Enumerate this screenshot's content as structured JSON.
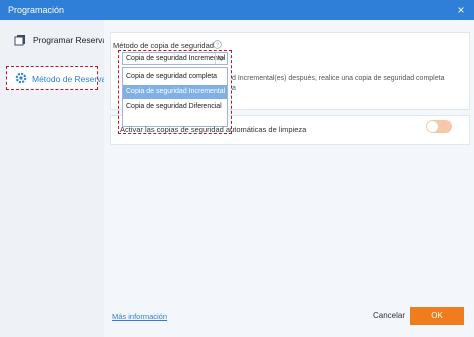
{
  "window": {
    "title": "Programación",
    "close_glyph": "×"
  },
  "sidebar": {
    "items": [
      {
        "label": "Programar Reserva",
        "icon": "copy-icon"
      },
      {
        "label": "Método de Reserva",
        "icon": "gear-icon"
      }
    ]
  },
  "backup_method": {
    "label": "Método de copia de seguridad",
    "selected": "Copia de seguridad Incremental",
    "options": [
      "Copia de seguridad completa",
      "Copia de seguridad Incremental",
      "Copia de seguridad Diferencial"
    ],
    "description_partial_1": "d Incremental(es) después, realice una copia de seguridad completa",
    "description_partial_2": "a"
  },
  "auto_cleanup": {
    "label": "Activar las copias de seguridad automáticas de limpieza",
    "enabled": false
  },
  "footer": {
    "more_info": "Más información",
    "cancel": "Cancelar",
    "ok": "OK"
  },
  "colors": {
    "accent": "#2f7fd8",
    "ok": "#f07c1d",
    "highlight": "#c8102e"
  }
}
